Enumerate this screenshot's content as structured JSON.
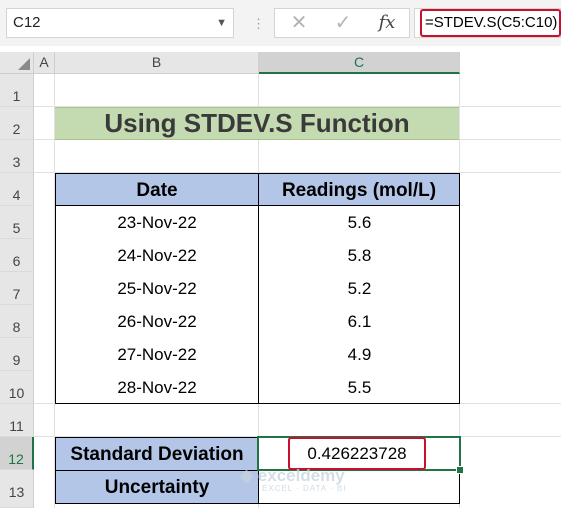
{
  "formula_bar": {
    "name_box": "C12",
    "separator": "⋮",
    "cancel_symbol": "✕",
    "enter_symbol": "✓",
    "fx_symbol": "fx",
    "formula": "=STDEV.S(C5:C10)"
  },
  "columns": [
    "A",
    "B",
    "C"
  ],
  "rows": [
    "1",
    "2",
    "3",
    "4",
    "5",
    "6",
    "7",
    "8",
    "9",
    "10",
    "11",
    "12",
    "13"
  ],
  "sheet": {
    "title": "Using STDEV.S Function",
    "headers": {
      "date": "Date",
      "readings": "Readings (mol/L)"
    },
    "data": [
      {
        "date": "23-Nov-22",
        "reading": "5.6"
      },
      {
        "date": "24-Nov-22",
        "reading": "5.8"
      },
      {
        "date": "25-Nov-22",
        "reading": "5.2"
      },
      {
        "date": "26-Nov-22",
        "reading": "6.1"
      },
      {
        "date": "27-Nov-22",
        "reading": "4.9"
      },
      {
        "date": "28-Nov-22",
        "reading": "5.5"
      }
    ],
    "std_label": "Standard Deviation",
    "std_value": "0.426223728",
    "uncertainty_label": "Uncertainty",
    "uncertainty_value": ""
  },
  "watermark": {
    "brand": "exceldemy",
    "tagline": "EXCEL · DATA · BI"
  },
  "colors": {
    "accent": "#217346",
    "highlight": "#c8102e",
    "header_fill": "#b4c6e7",
    "title_fill": "#c4dbb2"
  }
}
